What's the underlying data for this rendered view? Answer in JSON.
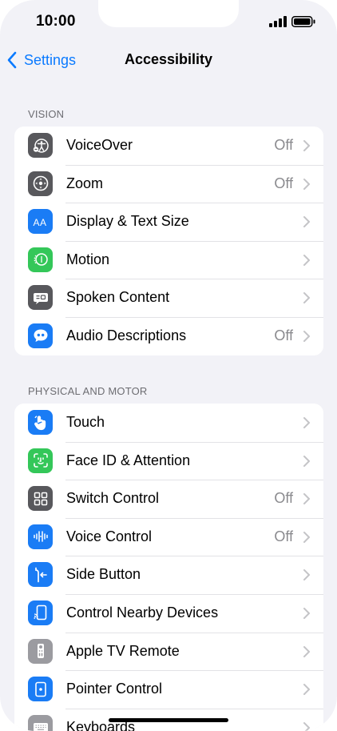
{
  "status": {
    "time": "10:00"
  },
  "nav": {
    "back_label": "Settings",
    "title": "Accessibility"
  },
  "colors": {
    "accent": "#0a7aff",
    "dark_gray": "#58585c",
    "blue": "#1a7cf5",
    "green": "#34c759",
    "light_gray": "#9b9ba0"
  },
  "sections": [
    {
      "header": "VISION",
      "items": [
        {
          "label": "VoiceOver",
          "value": "Off",
          "icon": "voiceover-icon"
        },
        {
          "label": "Zoom",
          "value": "Off",
          "icon": "zoom-icon"
        },
        {
          "label": "Display & Text Size",
          "value": "",
          "icon": "display-text-size-icon"
        },
        {
          "label": "Motion",
          "value": "",
          "icon": "motion-icon"
        },
        {
          "label": "Spoken Content",
          "value": "",
          "icon": "spoken-content-icon"
        },
        {
          "label": "Audio Descriptions",
          "value": "Off",
          "icon": "audio-descriptions-icon"
        }
      ]
    },
    {
      "header": "PHYSICAL AND MOTOR",
      "items": [
        {
          "label": "Touch",
          "value": "",
          "icon": "touch-icon"
        },
        {
          "label": "Face ID & Attention",
          "value": "",
          "icon": "face-id-icon"
        },
        {
          "label": "Switch Control",
          "value": "Off",
          "icon": "switch-control-icon"
        },
        {
          "label": "Voice Control",
          "value": "Off",
          "icon": "voice-control-icon"
        },
        {
          "label": "Side Button",
          "value": "",
          "icon": "side-button-icon"
        },
        {
          "label": "Control Nearby Devices",
          "value": "",
          "icon": "control-nearby-devices-icon"
        },
        {
          "label": "Apple TV Remote",
          "value": "",
          "icon": "apple-tv-remote-icon"
        },
        {
          "label": "Pointer Control",
          "value": "",
          "icon": "pointer-control-icon"
        },
        {
          "label": "Keyboards",
          "value": "",
          "icon": "keyboards-icon"
        }
      ]
    }
  ]
}
